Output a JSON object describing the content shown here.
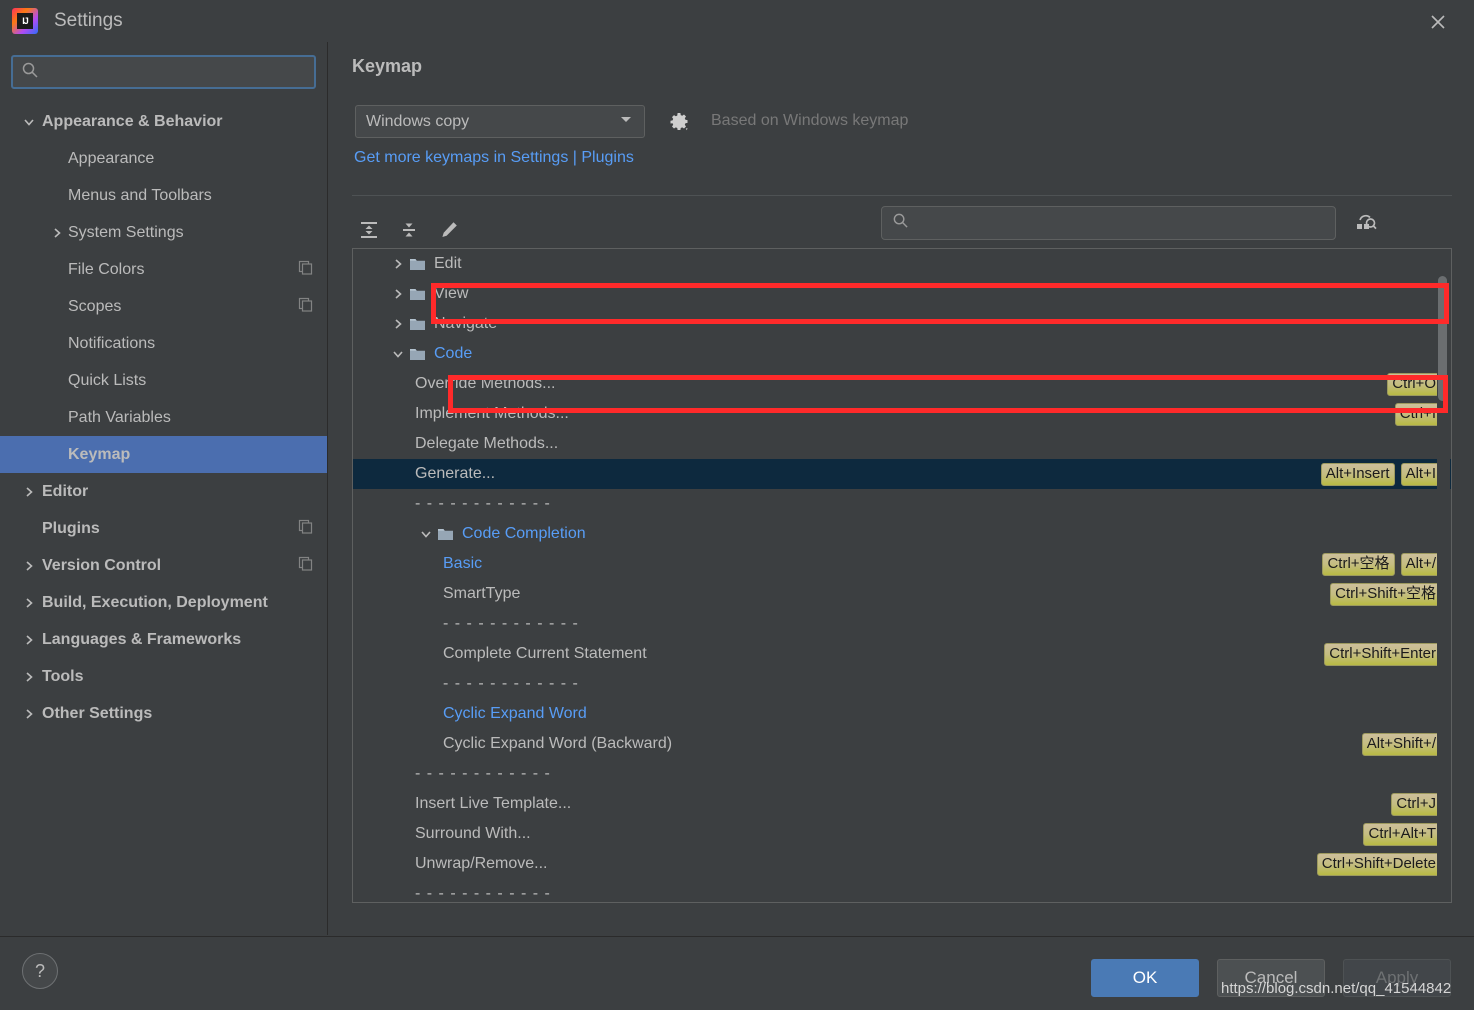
{
  "window": {
    "title": "Settings",
    "logo_text": "IJ",
    "close_icon": "close-icon"
  },
  "sidebar": {
    "search": {
      "value": "",
      "placeholder": ""
    },
    "items": [
      {
        "label": "Appearance & Behavior",
        "depth": 0,
        "arrow": "chevron-down",
        "bold": true,
        "copy": false,
        "selected": false
      },
      {
        "label": "Appearance",
        "depth": 1,
        "arrow": "none",
        "bold": false,
        "copy": false,
        "selected": false
      },
      {
        "label": "Menus and Toolbars",
        "depth": 1,
        "arrow": "none",
        "bold": false,
        "copy": false,
        "selected": false
      },
      {
        "label": "System Settings",
        "depth": 1,
        "arrow": "chevron-right",
        "bold": false,
        "copy": false,
        "selected": false
      },
      {
        "label": "File Colors",
        "depth": 1,
        "arrow": "none",
        "bold": false,
        "copy": true,
        "selected": false
      },
      {
        "label": "Scopes",
        "depth": 1,
        "arrow": "none",
        "bold": false,
        "copy": true,
        "selected": false
      },
      {
        "label": "Notifications",
        "depth": 1,
        "arrow": "none",
        "bold": false,
        "copy": false,
        "selected": false
      },
      {
        "label": "Quick Lists",
        "depth": 1,
        "arrow": "none",
        "bold": false,
        "copy": false,
        "selected": false
      },
      {
        "label": "Path Variables",
        "depth": 1,
        "arrow": "none",
        "bold": false,
        "copy": false,
        "selected": false
      },
      {
        "label": "Keymap",
        "depth": 1,
        "arrow": "none",
        "bold": true,
        "copy": false,
        "selected": true
      },
      {
        "label": "Editor",
        "depth": 0,
        "arrow": "chevron-right",
        "bold": true,
        "copy": false,
        "selected": false
      },
      {
        "label": "Plugins",
        "depth": 0,
        "arrow": "none",
        "bold": true,
        "copy": true,
        "selected": false
      },
      {
        "label": "Version Control",
        "depth": 0,
        "arrow": "chevron-right",
        "bold": true,
        "copy": true,
        "selected": false
      },
      {
        "label": "Build, Execution, Deployment",
        "depth": 0,
        "arrow": "chevron-right",
        "bold": true,
        "copy": false,
        "selected": false
      },
      {
        "label": "Languages & Frameworks",
        "depth": 0,
        "arrow": "chevron-right",
        "bold": true,
        "copy": false,
        "selected": false
      },
      {
        "label": "Tools",
        "depth": 0,
        "arrow": "chevron-right",
        "bold": true,
        "copy": false,
        "selected": false
      },
      {
        "label": "Other Settings",
        "depth": 0,
        "arrow": "chevron-right",
        "bold": true,
        "copy": false,
        "selected": false
      }
    ]
  },
  "main": {
    "page_title": "Keymap",
    "keymap_select": {
      "value": "Windows copy",
      "arrow_icon": "chevron-down-icon"
    },
    "gear_icon": "gear-icon",
    "based_on": "Based on Windows keymap",
    "plugins_link": "Get more keymaps in Settings | Plugins",
    "toolbar": {
      "expand_all_icon": "expand-all-icon",
      "collapse_all_icon": "collapse-all-icon",
      "edit_icon": "edit-pencil-icon",
      "find_by_shortcut_icon": "find-by-shortcut-icon"
    },
    "tree_search": {
      "value": "",
      "placeholder": ""
    },
    "action_rows": [
      {
        "label": "Edit",
        "depth": 1,
        "fold": "chevron-right",
        "folder": true,
        "blue": false,
        "selected": false,
        "shortcuts": []
      },
      {
        "label": "View",
        "depth": 1,
        "fold": "chevron-right",
        "folder": true,
        "blue": false,
        "selected": false,
        "shortcuts": []
      },
      {
        "label": "Navigate",
        "depth": 1,
        "fold": "chevron-right",
        "folder": true,
        "blue": false,
        "selected": false,
        "shortcuts": []
      },
      {
        "label": "Code",
        "depth": 1,
        "fold": "chevron-down",
        "folder": true,
        "blue": true,
        "selected": false,
        "shortcuts": []
      },
      {
        "label": "Override Methods...",
        "depth": 2,
        "fold": "none",
        "folder": false,
        "blue": false,
        "selected": false,
        "shortcuts": [
          "Ctrl+O"
        ]
      },
      {
        "label": "Implement Methods...",
        "depth": 2,
        "fold": "none",
        "folder": false,
        "blue": false,
        "selected": false,
        "shortcuts": [
          "Ctrl+I"
        ]
      },
      {
        "label": "Delegate Methods...",
        "depth": 2,
        "fold": "none",
        "folder": false,
        "blue": false,
        "selected": false,
        "shortcuts": []
      },
      {
        "label": "Generate...",
        "depth": 2,
        "fold": "none",
        "folder": false,
        "blue": false,
        "selected": true,
        "shortcuts": [
          "Alt+Insert",
          "Alt+I"
        ]
      },
      {
        "label": "- - - - - - - - - - - -",
        "depth": 2,
        "fold": "none",
        "folder": false,
        "blue": false,
        "selected": false,
        "shortcuts": [],
        "divider": true
      },
      {
        "label": "Code Completion",
        "depth": 2,
        "fold": "chevron-down",
        "folder": true,
        "blue": true,
        "selected": false,
        "shortcuts": []
      },
      {
        "label": "Basic",
        "depth": 3,
        "fold": "none",
        "folder": false,
        "blue": true,
        "selected": false,
        "shortcuts": [
          "Ctrl+空格",
          "Alt+/"
        ]
      },
      {
        "label": "SmartType",
        "depth": 3,
        "fold": "none",
        "folder": false,
        "blue": false,
        "selected": false,
        "shortcuts": [
          "Ctrl+Shift+空格"
        ]
      },
      {
        "label": "- - - - - - - - - - - -",
        "depth": 3,
        "fold": "none",
        "folder": false,
        "blue": false,
        "selected": false,
        "shortcuts": [],
        "divider": true
      },
      {
        "label": "Complete Current Statement",
        "depth": 3,
        "fold": "none",
        "folder": false,
        "blue": false,
        "selected": false,
        "shortcuts": [
          "Ctrl+Shift+Enter"
        ]
      },
      {
        "label": "- - - - - - - - - - - -",
        "depth": 3,
        "fold": "none",
        "folder": false,
        "blue": false,
        "selected": false,
        "shortcuts": [],
        "divider": true
      },
      {
        "label": "Cyclic Expand Word",
        "depth": 3,
        "fold": "none",
        "folder": false,
        "blue": true,
        "selected": false,
        "shortcuts": []
      },
      {
        "label": "Cyclic Expand Word (Backward)",
        "depth": 3,
        "fold": "none",
        "folder": false,
        "blue": false,
        "selected": false,
        "shortcuts": [
          "Alt+Shift+/"
        ]
      },
      {
        "label": "- - - - - - - - - - - -",
        "depth": 2,
        "fold": "none",
        "folder": false,
        "blue": false,
        "selected": false,
        "shortcuts": [],
        "divider": true
      },
      {
        "label": "Insert Live Template...",
        "depth": 2,
        "fold": "none",
        "folder": false,
        "blue": false,
        "selected": false,
        "shortcuts": [
          "Ctrl+J"
        ]
      },
      {
        "label": "Surround With...",
        "depth": 2,
        "fold": "none",
        "folder": false,
        "blue": false,
        "selected": false,
        "shortcuts": [
          "Ctrl+Alt+T"
        ]
      },
      {
        "label": "Unwrap/Remove...",
        "depth": 2,
        "fold": "none",
        "folder": false,
        "blue": false,
        "selected": false,
        "shortcuts": [
          "Ctrl+Shift+Delete"
        ]
      },
      {
        "label": "- - - - - - - - - - - -",
        "depth": 2,
        "fold": "none",
        "folder": false,
        "blue": false,
        "selected": false,
        "shortcuts": [],
        "divider": true
      }
    ]
  },
  "footer": {
    "help_label": "?",
    "ok_label": "OK",
    "cancel_label": "Cancel",
    "apply_label": "Apply"
  },
  "watermark": "https://blog.csdn.net/qq_41544842",
  "colors": {
    "background": "#3c3f41",
    "selection_blue": "#4b6eaf",
    "row_selection": "#0d293e",
    "link_blue": "#589df6",
    "annotation_red": "#ff2a2a",
    "ok_button": "#4a7ab5",
    "shortcut_badge": "#c4bd80"
  }
}
